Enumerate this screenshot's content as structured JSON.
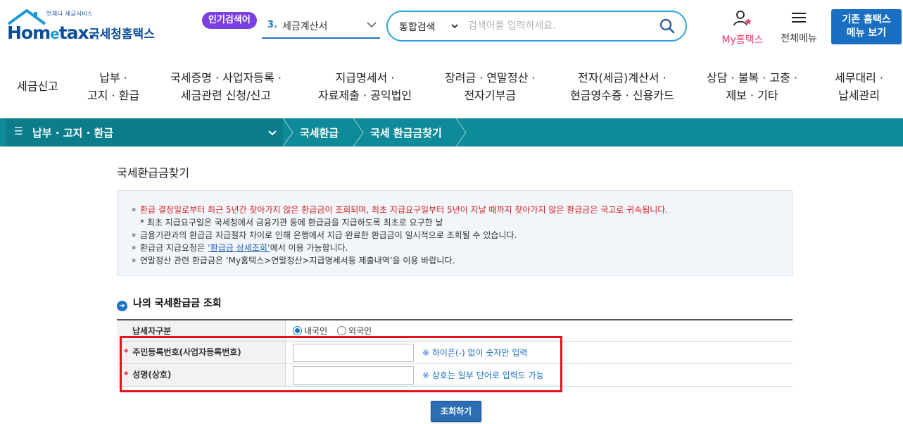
{
  "header": {
    "logo_small": "언제나 세금서비스",
    "logo_en_1": "Hom",
    "logo_en_e": "e",
    "logo_en_2": "tax.",
    "logo_ko": "국세청홈택스",
    "popular_badge": "인기검색어",
    "popular_rank": "3.",
    "popular_term": "세금계산서",
    "search_type": "통합검색",
    "search_placeholder": "검색어를 입력하세요.",
    "my_home_label": "My홈택스",
    "all_menu_label": "전체메뉴",
    "old_home_line1": "기존 홈택스",
    "old_home_line2": "메뉴 보기"
  },
  "nav": {
    "items": [
      {
        "line1": "세금신고",
        "line2": ""
      },
      {
        "line1": "납부 ·",
        "line2": "고지 · 환급"
      },
      {
        "line1": "국세증명 · 사업자등록 ·",
        "line2": "세금관련 신청/신고"
      },
      {
        "line1": "지급명세서 ·",
        "line2": "자료제출 · 공익법인"
      },
      {
        "line1": "장려금 · 연말정산 ·",
        "line2": "전자기부금"
      },
      {
        "line1": "전자(세금)계산서 ·",
        "line2": "현금영수증 · 신용카드"
      },
      {
        "line1": "상담 · 불복 · 고충 ·",
        "line2": "제보 · 기타"
      },
      {
        "line1": "세무대리 ·",
        "line2": "납세관리"
      }
    ]
  },
  "breadcrumb": {
    "first": "납부 · 고지 · 환급",
    "second": "국세환급",
    "third": "국세 환급금찾기"
  },
  "page": {
    "title": "국세환급금찾기",
    "notices": {
      "n1": "환급 결정일로부터 최근 5년간 찾아가지 않은 환급금이 조회되며, 최초 지급요구일부터 5년이 지날 때까지 찾아가지 않은 환급금은 국고로 귀속됩니다.",
      "n1_sub": "* 최초 지급요구일은 국세청에서 금융기관 등에 환급금을 지급하도록 최초로 요구한 날",
      "n2": "금융기관과의 환급금 지급절차 차이로 인해 은행에서 지급 완료한 환급금이 일시적으로 조회될 수 있습니다.",
      "n3_before": "환급금 지급요청은 ",
      "n3_link": "‘환급금 상세조회’",
      "n3_after": "에서 이용 가능합니다.",
      "n4": "연말정산 관련 환급금은 ‘My홈택스>연말정산>지급명세서등 제출내역’을 이용 바랍니다."
    },
    "section_title": "나의 국세환급금 조회",
    "form": {
      "taxpayer_type_label": "납세자구분",
      "option_domestic": "내국인",
      "option_foreign": "외국인",
      "selected": "내국인",
      "id_label": "주민등록번호(사업자등록번호)",
      "id_value": "",
      "id_hint": "※ 하이픈(-) 없이 숫자만 입력",
      "name_label": "성명(상호)",
      "name_value": "",
      "name_hint": "※ 상호는 일부 단어로 입력도 가능",
      "required_mark": "*"
    },
    "search_button": "조회하기"
  },
  "colors": {
    "brand_blue": "#0a4e9b",
    "teal_bar": "#0e8a99",
    "badge_purple": "#7b3fe4",
    "highlight_red": "#e0141e",
    "my_pink": "#e73a6a"
  }
}
